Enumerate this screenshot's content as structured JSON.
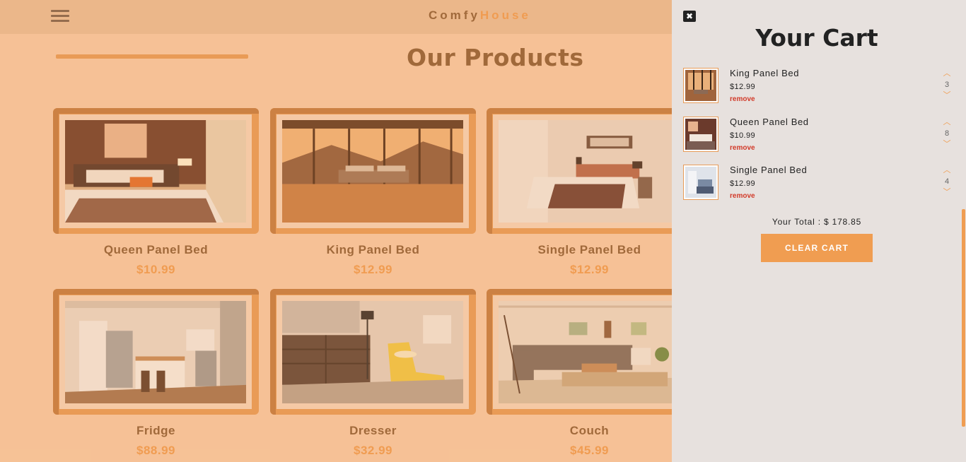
{
  "brand": {
    "part1": "Comfy",
    "part2": "House"
  },
  "section": {
    "title": "Our Products"
  },
  "products": [
    {
      "name": "Queen Panel Bed",
      "price": "$10.99",
      "photo": "bedroom-photo"
    },
    {
      "name": "King Panel Bed",
      "price": "$12.99",
      "photo": "bedroom-photo"
    },
    {
      "name": "Single Panel Bed",
      "price": "$12.99",
      "photo": "bedroom-photo"
    },
    {
      "name": "Fridge",
      "price": "$88.99",
      "photo": "kitchen-photo"
    },
    {
      "name": "Dresser",
      "price": "$32.99",
      "photo": "room-photo"
    },
    {
      "name": "Couch",
      "price": "$45.99",
      "photo": "living-room-photo"
    }
  ],
  "cart": {
    "title": "Your Cart",
    "items": [
      {
        "name": "King Panel Bed",
        "price": "$12.99",
        "remove": "remove",
        "qty": "3"
      },
      {
        "name": "Queen Panel Bed",
        "price": "$10.99",
        "remove": "remove",
        "qty": "8"
      },
      {
        "name": "Single Panel Bed",
        "price": "$12.99",
        "remove": "remove",
        "qty": "4"
      }
    ],
    "total_label": "Your Total : $ 178.85",
    "clear_label": "CLEAR CART"
  },
  "icons": {
    "menu": "menu-icon",
    "close": "close-icon",
    "up": "chevron-up-icon",
    "down": "chevron-down-icon"
  },
  "colors": {
    "accent": "#f09d51",
    "brown": "#8a5b34",
    "cart_bg": "#e7e1de",
    "page_bg": "#f8ccaa"
  }
}
